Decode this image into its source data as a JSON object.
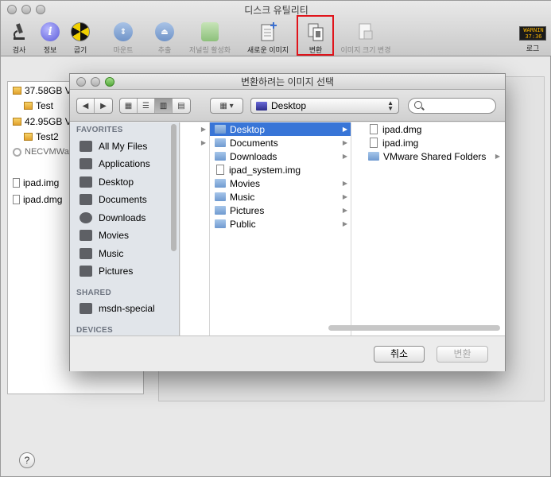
{
  "window": {
    "title": "디스크 유틸리티"
  },
  "toolbar": {
    "items": [
      {
        "label": "검사",
        "icon": "microscope-icon"
      },
      {
        "label": "정보",
        "icon": "info-icon"
      },
      {
        "label": "굽기",
        "icon": "burn-icon"
      },
      {
        "label": "마운트",
        "icon": "mount-icon"
      },
      {
        "label": "추출",
        "icon": "eject-icon"
      },
      {
        "label": "저널링 활성화",
        "icon": "journal-icon"
      },
      {
        "label": "새로운 이미지",
        "icon": "new-image-icon"
      },
      {
        "label": "변환",
        "icon": "convert-icon"
      },
      {
        "label": "이미지 크기 변경",
        "icon": "resize-image-icon"
      },
      {
        "label": "로그",
        "icon": "log-icon"
      }
    ],
    "log_badge": "WARNIN\n37:36"
  },
  "sidebar": {
    "items": [
      {
        "label": "37.58GB V",
        "type": "disk"
      },
      {
        "label": "Test",
        "type": "volume"
      },
      {
        "label": "42.95GB V",
        "type": "disk"
      },
      {
        "label": "Test2",
        "type": "volume"
      },
      {
        "label": "NECVMWa",
        "type": "optical"
      },
      {
        "label": "ipad.img",
        "type": "image"
      },
      {
        "label": "ipad.dmg",
        "type": "image"
      }
    ]
  },
  "help_label": "?",
  "dialog": {
    "title": "변환하려는 이미지 선택",
    "location": "Desktop",
    "search_placeholder": "",
    "favorites_header": "FAVORITES",
    "favorites": [
      "All My Files",
      "Applications",
      "Desktop",
      "Documents",
      "Downloads",
      "Movies",
      "Music",
      "Pictures"
    ],
    "shared_header": "SHARED",
    "shared": [
      "msdn-special"
    ],
    "devices_header": "DEVICES",
    "column2": [
      {
        "name": "Desktop",
        "type": "folder",
        "arrow": true,
        "selected": true
      },
      {
        "name": "Documents",
        "type": "folder",
        "arrow": true
      },
      {
        "name": "Downloads",
        "type": "folder",
        "arrow": true
      },
      {
        "name": "ipad_system.img",
        "type": "doc",
        "arrow": false
      },
      {
        "name": "Movies",
        "type": "folder",
        "arrow": true
      },
      {
        "name": "Music",
        "type": "folder",
        "arrow": true
      },
      {
        "name": "Pictures",
        "type": "folder",
        "arrow": true
      },
      {
        "name": "Public",
        "type": "folder",
        "arrow": true
      }
    ],
    "column3": [
      {
        "name": "ipad.dmg",
        "type": "doc",
        "arrow": false
      },
      {
        "name": "ipad.img",
        "type": "doc",
        "arrow": false
      },
      {
        "name": "VMware Shared Folders",
        "type": "folder",
        "arrow": true
      }
    ],
    "cancel_label": "취소",
    "convert_label": "변환"
  }
}
